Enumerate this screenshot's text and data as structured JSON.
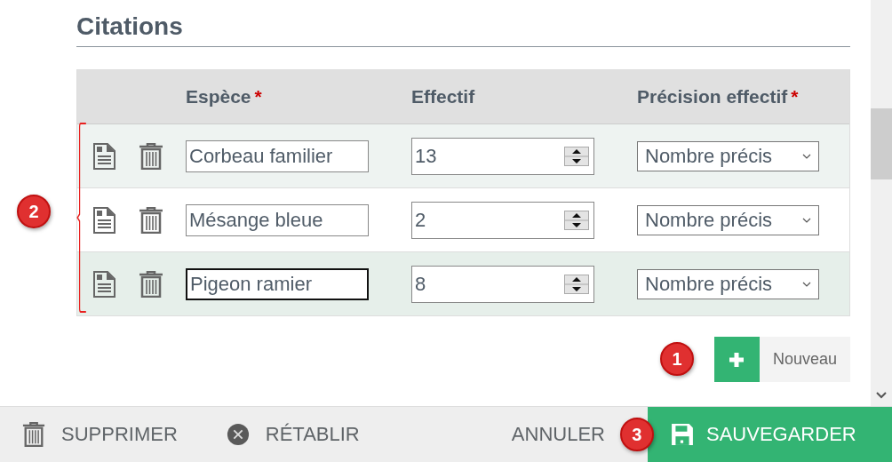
{
  "section": {
    "title": "Citations"
  },
  "columns": [
    {
      "label": "Espèce",
      "required_mark": "*"
    },
    {
      "label": "Effectif"
    },
    {
      "label": "Précision effectif",
      "required_mark": "*"
    }
  ],
  "rows": [
    {
      "species": "Corbeau familier",
      "count": "13",
      "precision": "Nombre précis",
      "focused": false
    },
    {
      "species": "Mésange bleue",
      "count": "2",
      "precision": "Nombre précis",
      "focused": false
    },
    {
      "species": "Pigeon ramier",
      "count": "8",
      "precision": "Nombre précis",
      "focused": true
    }
  ],
  "add_button": {
    "label": "Nouveau"
  },
  "annotations": [
    {
      "number": "1"
    },
    {
      "number": "2"
    },
    {
      "number": "3"
    }
  ],
  "footer": [
    {
      "label": "SUPPRIMER",
      "kind": "delete"
    },
    {
      "label": "RÉTABLIR",
      "kind": "reset"
    },
    {
      "label": "ANNULER",
      "kind": "cancel"
    },
    {
      "label": "SAUVEGARDER",
      "kind": "save"
    }
  ]
}
